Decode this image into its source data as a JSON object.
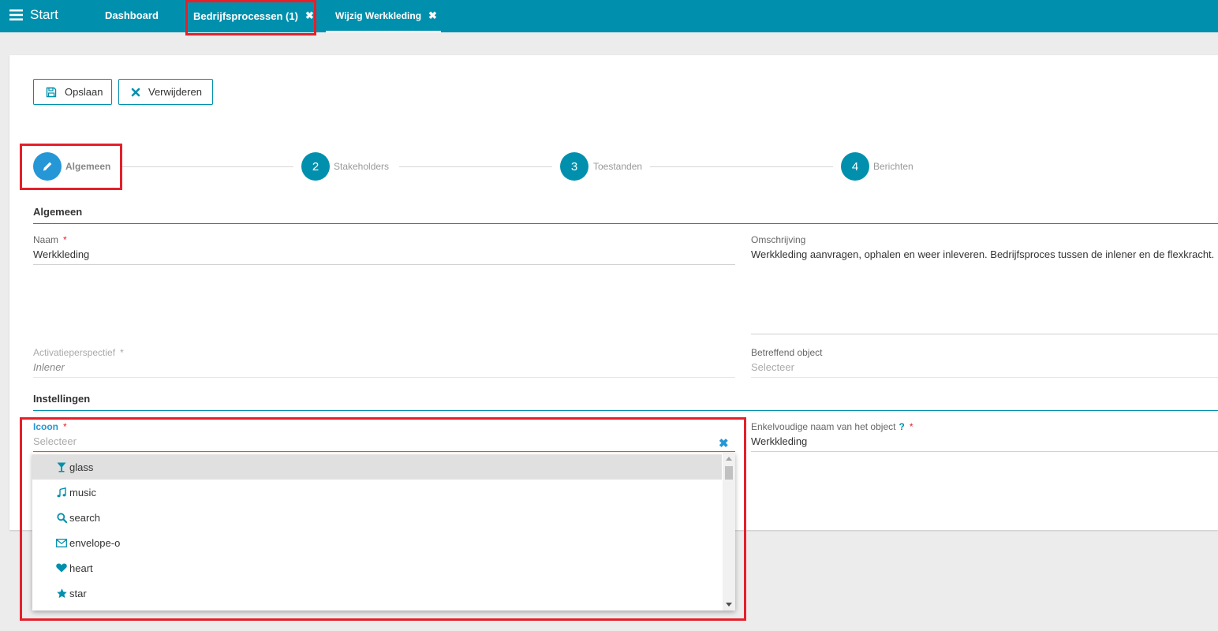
{
  "topbar": {
    "start_label": "Start",
    "tabs": [
      {
        "label": "Dashboard"
      },
      {
        "label": "Bedrijfsprocessen (1)",
        "close": "✖"
      },
      {
        "label": "Wijzig Werkkleding",
        "close": "✖"
      }
    ]
  },
  "toolbar": {
    "save_label": "Opslaan",
    "delete_label": "Verwijderen"
  },
  "stepper": {
    "steps": [
      {
        "number": "",
        "label": "Algemeen"
      },
      {
        "number": "2",
        "label": "Stakeholders"
      },
      {
        "number": "3",
        "label": "Toestanden"
      },
      {
        "number": "4",
        "label": "Berichten"
      }
    ]
  },
  "sections": {
    "general": "Algemeen",
    "settings": "Instellingen"
  },
  "form": {
    "naam": {
      "label": "Naam",
      "required": "*",
      "value": "Werkkleding"
    },
    "omschrijving": {
      "label": "Omschrijving",
      "value": "Werkkleding aanvragen, ophalen en weer inleveren. Bedrijfsproces tussen de inlener en de flexkracht."
    },
    "activatieperspectief": {
      "label": "Activatieperspectief",
      "required": "*",
      "value": "Inlener"
    },
    "betreffend_object": {
      "label": "Betreffend object",
      "placeholder": "Selecteer"
    },
    "icoon": {
      "label": "Icoon",
      "required": "*",
      "placeholder": "Selecteer",
      "clear": "✖"
    },
    "enkelvoudige_naam": {
      "label": "Enkelvoudige naam van het object",
      "help": "?",
      "required": "*",
      "value": "Werkkleding"
    }
  },
  "dropdown": {
    "options": [
      {
        "label": "glass",
        "icon": "glass-icon"
      },
      {
        "label": "music",
        "icon": "music-icon"
      },
      {
        "label": "search",
        "icon": "search-icon"
      },
      {
        "label": "envelope-o",
        "icon": "envelope-o-icon"
      },
      {
        "label": "heart",
        "icon": "heart-icon"
      },
      {
        "label": "star",
        "icon": "star-icon"
      }
    ]
  },
  "colors": {
    "primary": "#0090ad",
    "active_step": "#2596d6",
    "required": "#e4202b",
    "highlight": "#e4202b"
  }
}
